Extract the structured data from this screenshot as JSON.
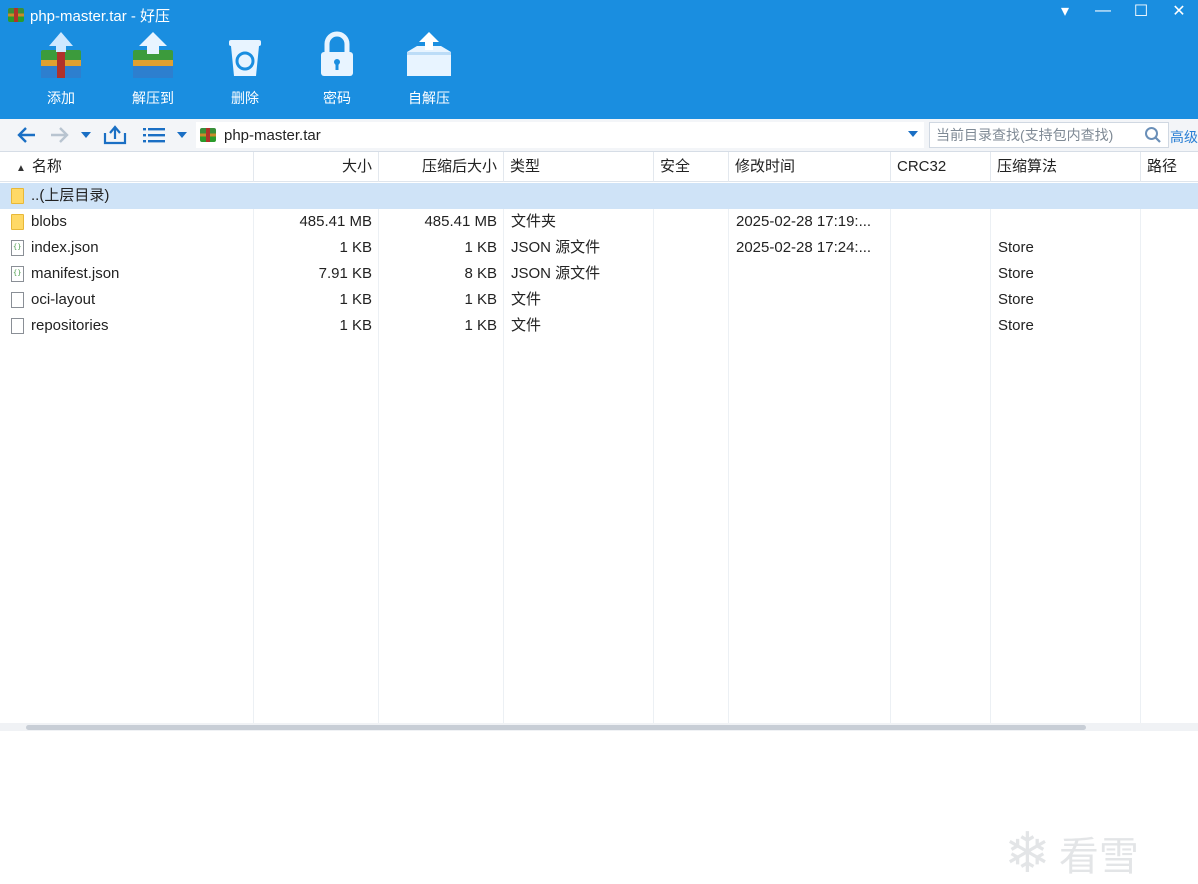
{
  "window": {
    "title": "php-master.tar - 好压",
    "controls": [
      "▾",
      "—",
      "☐",
      "✕"
    ]
  },
  "toolbar": {
    "add_label": "添加",
    "extract_label": "解压到",
    "delete_label": "删除",
    "password_label": "密码",
    "selfextract_label": "自解压"
  },
  "address": {
    "path": "php-master.tar",
    "search_placeholder": "当前目录查找(支持包内查找)",
    "advanced_label": "高级"
  },
  "columns": {
    "name": "名称",
    "size": "大小",
    "packed": "压缩后大小",
    "type": "类型",
    "security": "安全",
    "modified": "修改时间",
    "crc": "CRC32",
    "method": "压缩算法",
    "path": "路径"
  },
  "rows": [
    {
      "icon": "folder",
      "name": "..(上层目录)",
      "size": "",
      "packed": "",
      "type": "",
      "security": "",
      "modified": "",
      "crc": "",
      "method": ""
    },
    {
      "icon": "folder",
      "name": "blobs",
      "size": "485.41 MB",
      "packed": "485.41 MB",
      "type": "文件夹",
      "security": "",
      "modified": "2025-02-28 17:19:...",
      "crc": "",
      "method": ""
    },
    {
      "icon": "json",
      "name": "index.json",
      "size": "1 KB",
      "packed": "1 KB",
      "type": "JSON 源文件",
      "security": "",
      "modified": "2025-02-28 17:24:...",
      "crc": "",
      "method": "Store"
    },
    {
      "icon": "json",
      "name": "manifest.json",
      "size": "7.91 KB",
      "packed": "8 KB",
      "type": "JSON 源文件",
      "security": "",
      "modified": "",
      "crc": "",
      "method": "Store"
    },
    {
      "icon": "file",
      "name": "oci-layout",
      "size": "1 KB",
      "packed": "1 KB",
      "type": "文件",
      "security": "",
      "modified": "",
      "crc": "",
      "method": "Store"
    },
    {
      "icon": "file",
      "name": "repositories",
      "size": "1 KB",
      "packed": "1 KB",
      "type": "文件",
      "security": "",
      "modified": "",
      "crc": "",
      "method": "Store"
    }
  ],
  "watermark": {
    "text": "看雪"
  },
  "colors": {
    "titlebar": "#1a8ee0",
    "selection": "#cfe3f7",
    "accent": "#1a6fc4"
  }
}
